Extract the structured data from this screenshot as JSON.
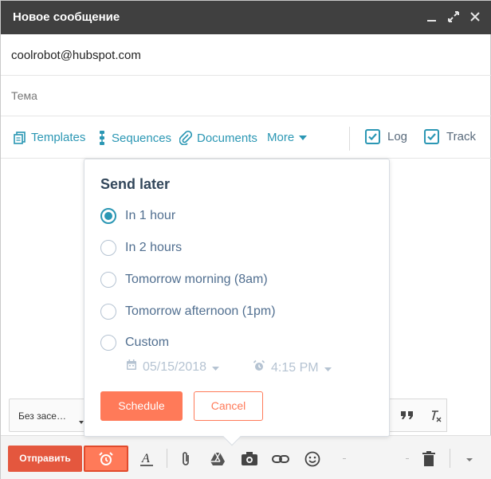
{
  "window": {
    "title": "Новое сообщение"
  },
  "compose": {
    "to_value": "coolrobot@hubspot.com",
    "subject_placeholder": "Тема"
  },
  "toolbar": {
    "templates": "Templates",
    "sequences": "Sequences",
    "documents": "Documents",
    "more": "More",
    "log": "Log",
    "track": "Track"
  },
  "send_later": {
    "heading": "Send later",
    "options": [
      {
        "label": "In 1 hour",
        "selected": true
      },
      {
        "label": "In 2 hours",
        "selected": false
      },
      {
        "label": "Tomorrow morning (8am)",
        "selected": false
      },
      {
        "label": "Tomorrow afternoon (1pm)",
        "selected": false
      },
      {
        "label": "Custom",
        "selected": false
      }
    ],
    "custom_date": "05/15/2018",
    "custom_time": "4:15 PM",
    "schedule_label": "Schedule",
    "cancel_label": "Cancel"
  },
  "format": {
    "font_label": "Без засе…"
  },
  "bottom": {
    "send_label": "Отправить"
  },
  "colors": {
    "accent": "#2b97b4",
    "orange": "#ff7a59",
    "send_red": "#e4573e",
    "titlebar": "#404040"
  }
}
